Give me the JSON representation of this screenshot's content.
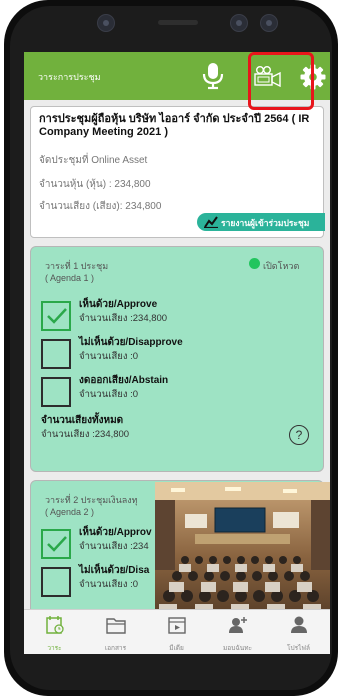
{
  "appbar": {
    "title": "วาระการประชุม"
  },
  "meeting": {
    "title": "การประชุมผู้ถือหุ้น บริษัท ไออาร์ จำกัด ประจำปี 2564 ( IR Company Meeting 2021 )",
    "location": "จัดประชุมที่ Online Asset",
    "shares": "จำนวนหุ้น (หุ้น) : 234,800",
    "votes": "จำนวนเสียง (เสียง): 234,800",
    "report_button": "รายงานผู้เข้าร่วมประชุม"
  },
  "agenda1": {
    "title": "วาระที่ 1 ประชุม",
    "subtitle": "( Agenda 1 )",
    "vote_status": "เปิดโหวต",
    "options": [
      {
        "label": "เห็นด้วย/Approve",
        "votes": "จำนวนเสียง :234,800",
        "checked": true
      },
      {
        "label": "ไม่เห็นด้วย/Disapprove",
        "votes": "จำนวนเสียง :0",
        "checked": false
      },
      {
        "label": "งดออกเสียง/Abstain",
        "votes": "จำนวนเสียง :0",
        "checked": false
      }
    ],
    "total_label": "จำนวนเสียงทั้งหมด",
    "total_value": "จำนวนเสียง :234,800",
    "help": "?"
  },
  "agenda2": {
    "title": "วาระที่ 2 ประชุมเงินลงทุ",
    "subtitle": "( Agenda 2 )",
    "options": [
      {
        "label": "เห็นด้วย/Approv",
        "votes": "จำนวนเสียง :234",
        "checked": true
      },
      {
        "label": "ไม่เห็นด้วย/Disa",
        "votes": "จำนวนเสียง :0",
        "checked": false
      }
    ]
  },
  "nav": [
    {
      "label": "วาระ",
      "icon": "agenda-icon"
    },
    {
      "label": "เอกสาร",
      "icon": "folder-icon"
    },
    {
      "label": "มีเดีย",
      "icon": "media-icon"
    },
    {
      "label": "มอบฉันทะ",
      "icon": "add-person-icon"
    },
    {
      "label": "โปรไฟล์",
      "icon": "profile-icon"
    }
  ],
  "colors": {
    "appbar": "#71b13d",
    "agenda_bg": "#9ee3c4",
    "report_button": "#2bb39a",
    "highlight": "#e8151b",
    "vote_dot": "#22c55e"
  }
}
